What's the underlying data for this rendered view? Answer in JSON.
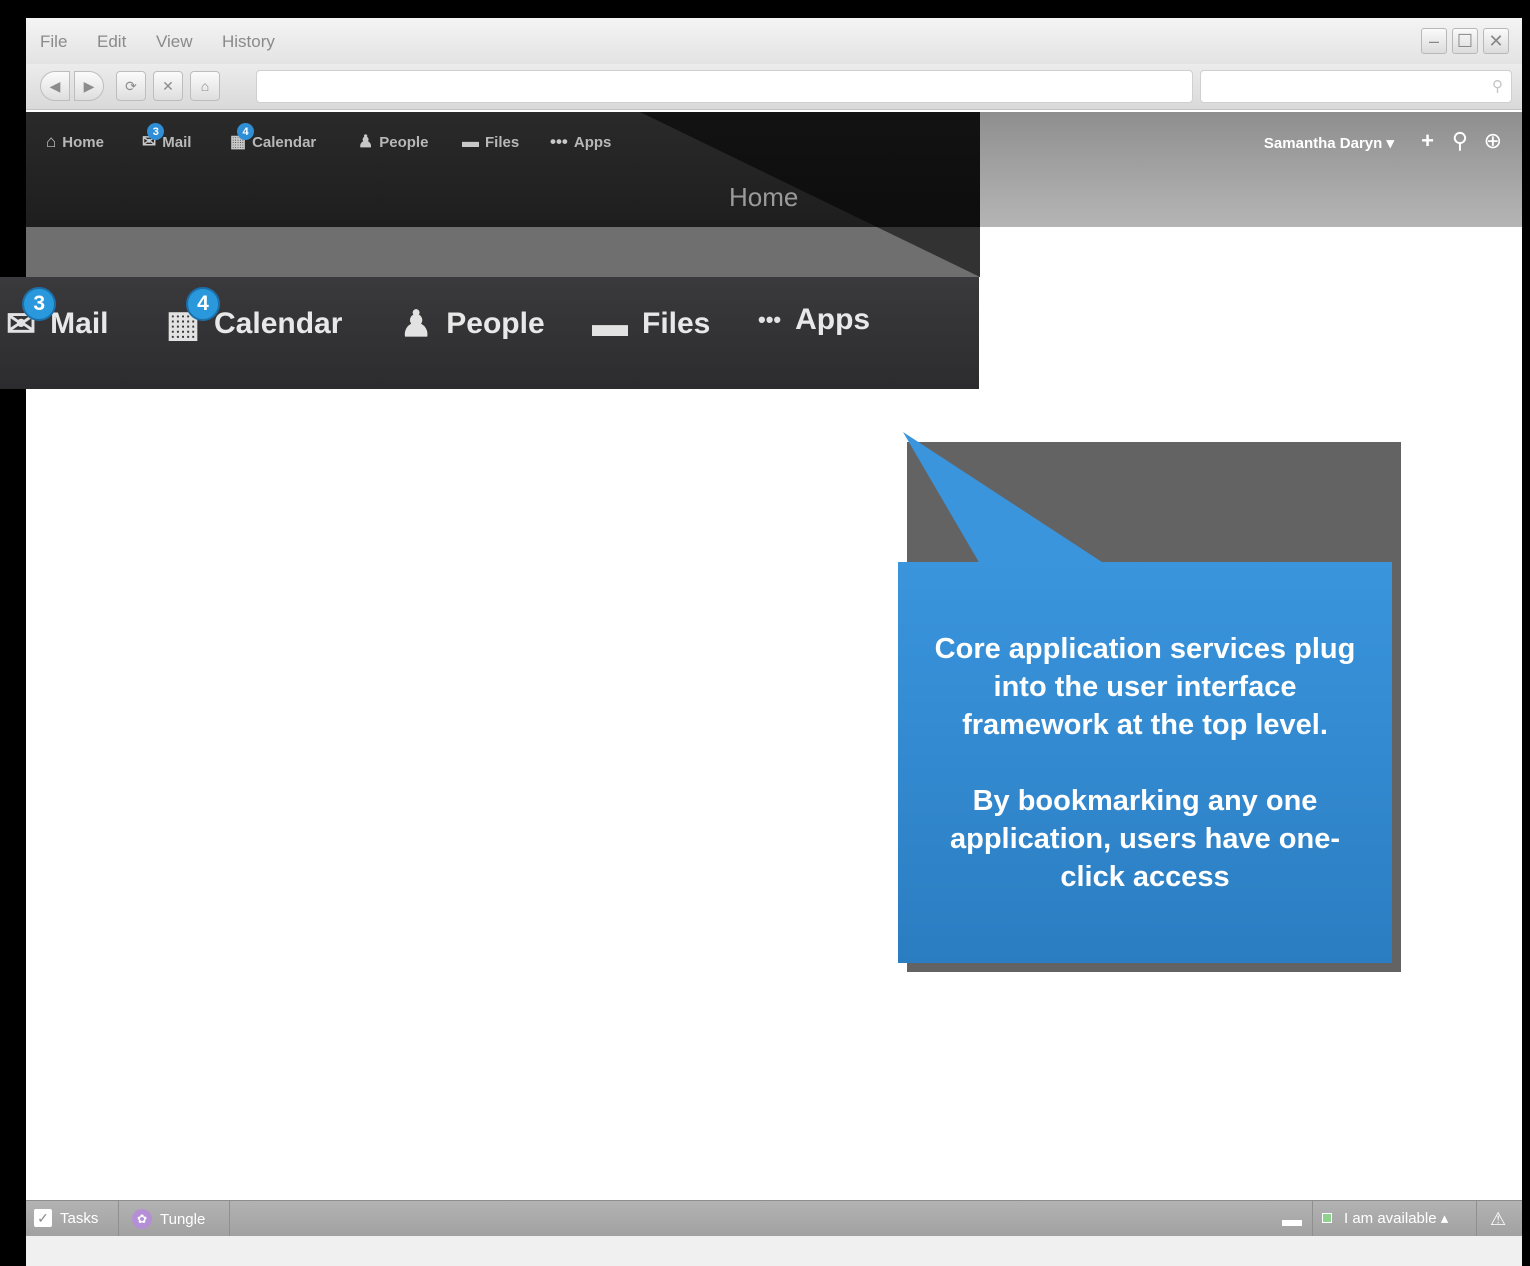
{
  "menubar": {
    "items": [
      "File",
      "Edit",
      "View",
      "History"
    ]
  },
  "window_controls": {
    "minimize": "–",
    "maximize": "☐",
    "close": "✕"
  },
  "toolbar": {
    "back": "◀",
    "forward": "▶",
    "reload": "⟳",
    "stop": "✕",
    "home": "⌂"
  },
  "header": {
    "nav": [
      {
        "label": "Home",
        "icon": "home-icon",
        "badge": ""
      },
      {
        "label": "Mail",
        "icon": "mail-icon",
        "badge": "3"
      },
      {
        "label": "Calendar",
        "icon": "calendar-icon",
        "badge": "4"
      },
      {
        "label": "People",
        "icon": "people-icon",
        "badge": ""
      },
      {
        "label": "Files",
        "icon": "folder-icon",
        "badge": ""
      },
      {
        "label": "Apps",
        "icon": "ellipsis-icon",
        "badge": ""
      }
    ],
    "page_title": "Home",
    "user_name": "Samantha Daryn ▾"
  },
  "zoom_nav": [
    {
      "label": "Mail",
      "badge": "3"
    },
    {
      "label": "Calendar",
      "badge": "4"
    },
    {
      "label": "People"
    },
    {
      "label": "Files"
    },
    {
      "label": "Apps"
    }
  ],
  "callout": {
    "para1": "Core application services plug into the user interface framework at the top level.",
    "para2": "By bookmarking any one application, users have one-click access"
  },
  "statusbar": {
    "tasks": "Tasks",
    "tungle": "Tungle",
    "availability": "I am available ▴"
  },
  "colors": {
    "accent": "#2e8ed6",
    "callout": "#3a95dd",
    "dark_nav": "#1e1e1e"
  }
}
